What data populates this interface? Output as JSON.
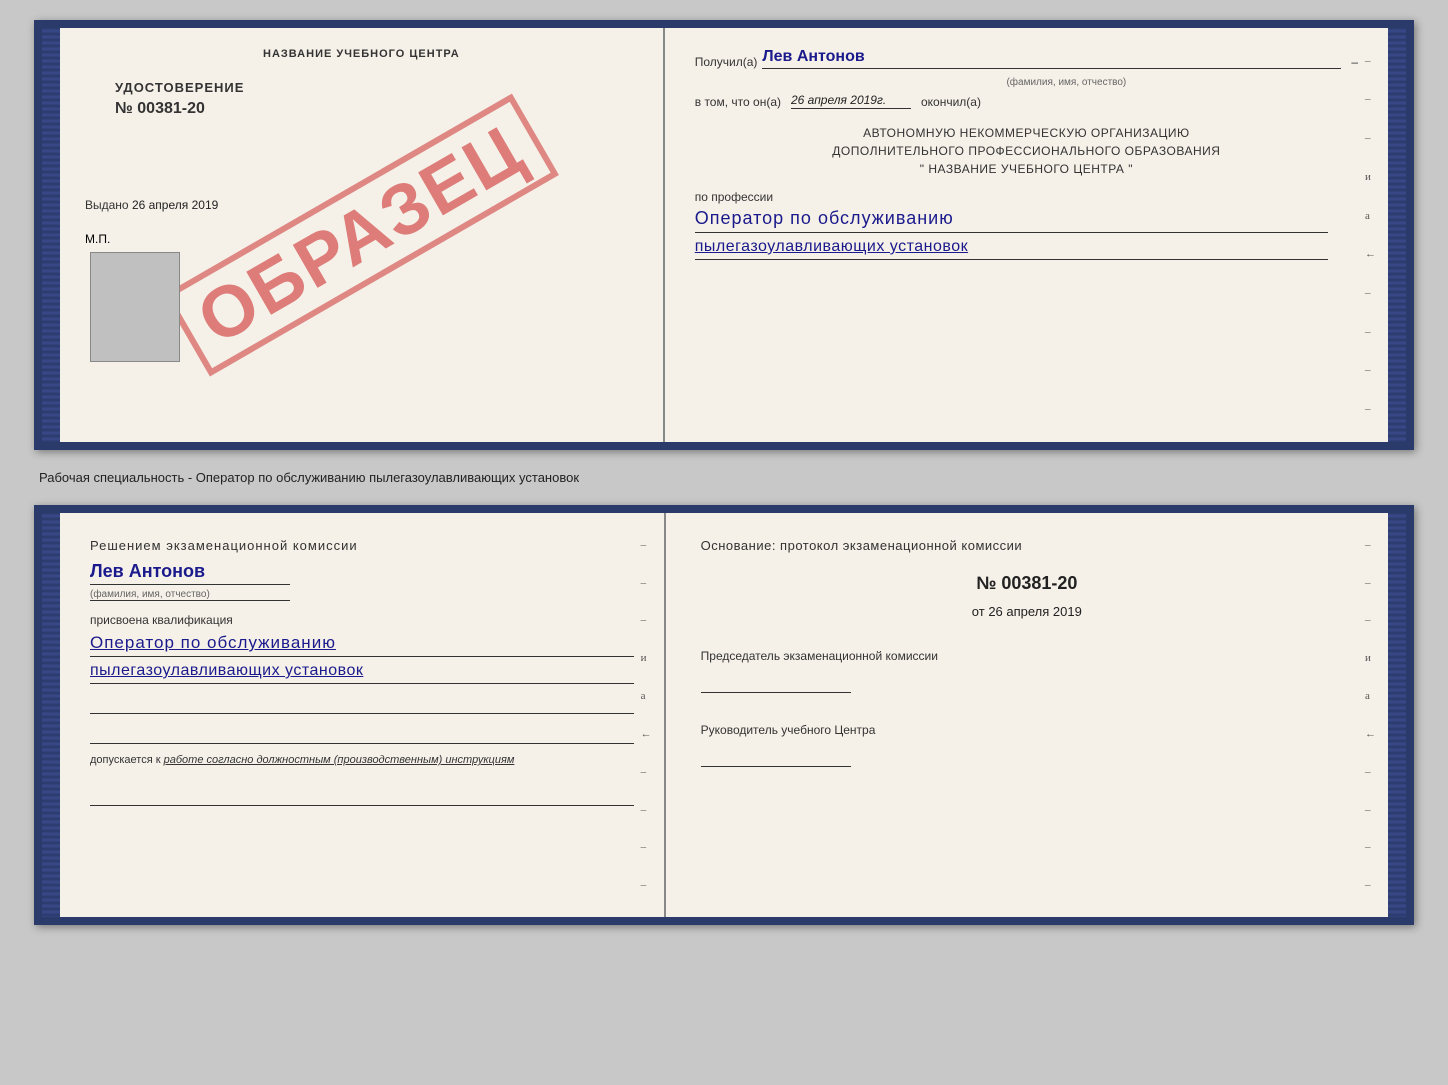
{
  "top_book": {
    "left_page": {
      "header": "НАЗВАНИЕ УЧЕБНОГО ЦЕНТРА",
      "udostoverenie_title": "УДОСТОВЕРЕНИЕ",
      "udostoverenie_number": "№ 00381-20",
      "vydano_label": "Выдано",
      "vydano_date": "26 апреля 2019",
      "mp_label": "М.П.",
      "obrazets": "ОБРАЗЕЦ"
    },
    "right_page": {
      "poluchil_label": "Получил(а)",
      "poluchil_name": "Лев Антонов",
      "fio_label": "(фамилия, имя, отчество)",
      "v_tom_label": "в том, что он(а)",
      "date_value": "26 апреля 2019г.",
      "okonchil_label": "окончил(а)",
      "org_line1": "АВТОНОМНУЮ НЕКОММЕРЧЕСКУЮ ОРГАНИЗАЦИЮ",
      "org_line2": "ДОПОЛНИТЕЛЬНОГО ПРОФЕССИОНАЛЬНОГО ОБРАЗОВАНИЯ",
      "org_line3": "\" НАЗВАНИЕ УЧЕБНОГО ЦЕНТРА \"",
      "po_professii_label": "по профессии",
      "profession_line1": "Оператор по обслуживанию",
      "profession_line2": "пылегазоулавливающих установок",
      "dashes": [
        "-",
        "-",
        "-",
        "и",
        "а",
        "←",
        "-",
        "-",
        "-",
        "-"
      ]
    }
  },
  "subtitle": "Рабочая специальность - Оператор по обслуживанию пылегазоулавливающих установок",
  "bottom_book": {
    "left_page": {
      "resheniem_label": "Решением экзаменационной комиссии",
      "person_name": "Лев Антонов",
      "fio_label": "(фамилия, имя, отчество)",
      "prisvoena_label": "присвоена квалификация",
      "kvalif_line1": "Оператор по обслуживанию",
      "kvalif_line2": "пылегазоулавливающих установок",
      "dopuskaetsya_prefix": "допускается к",
      "dopuskaetsya_italic": "работе согласно должностным (производственным) инструкциям",
      "dashes_right": [
        "-",
        "-",
        "-",
        "и",
        "а",
        "←",
        "-",
        "-",
        "-",
        "-"
      ]
    },
    "right_page": {
      "osnovanie_label": "Основание: протокол экзаменационной комиссии",
      "protocol_number": "№  00381-20",
      "ot_label": "от",
      "ot_date": "26 апреля 2019",
      "predsedatel_label": "Председатель экзаменационной комиссии",
      "rukovoditel_label": "Руководитель учебного Центра",
      "dashes_right": [
        "-",
        "-",
        "-",
        "и",
        "а",
        "←",
        "-",
        "-",
        "-",
        "-"
      ]
    }
  }
}
